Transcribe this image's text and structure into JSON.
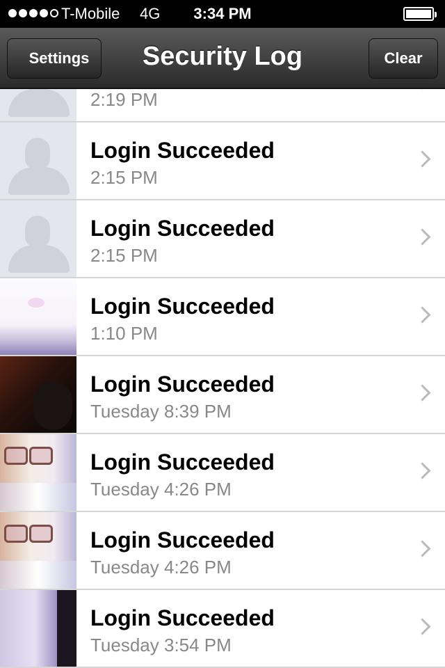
{
  "status_bar": {
    "carrier": "T-Mobile",
    "network": "4G",
    "time": "3:34 PM"
  },
  "nav": {
    "back_label": "Settings",
    "title": "Security Log",
    "action_label": "Clear"
  },
  "rows": [
    {
      "title": "",
      "time": "2:19 PM",
      "thumb": "placeholder"
    },
    {
      "title": "Login Succeeded",
      "time": "2:15 PM",
      "thumb": "placeholder"
    },
    {
      "title": "Login Succeeded",
      "time": "2:15 PM",
      "thumb": "placeholder"
    },
    {
      "title": "Login Succeeded",
      "time": "1:10 PM",
      "thumb": "photo-light"
    },
    {
      "title": "Login Succeeded",
      "time": "Tuesday 8:39 PM",
      "thumb": "photo-dark"
    },
    {
      "title": "Login Succeeded",
      "time": "Tuesday 4:26 PM",
      "thumb": "photo-glasses"
    },
    {
      "title": "Login Succeeded",
      "time": "Tuesday 4:26 PM",
      "thumb": "photo-glasses"
    },
    {
      "title": "Login Succeeded",
      "time": "Tuesday 3:54 PM",
      "thumb": "photo-purple"
    }
  ]
}
